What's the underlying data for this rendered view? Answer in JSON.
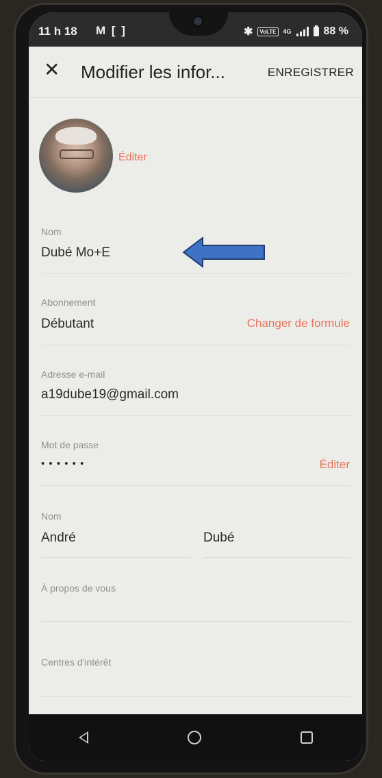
{
  "status_bar": {
    "time": "11 h 18",
    "left_icons": "M [ ]",
    "network_label": "4G",
    "volte_label": "VoLTE",
    "battery": "88 %"
  },
  "app_bar": {
    "title": "Modifier les infor...",
    "save_label": "ENREGISTRER"
  },
  "profile": {
    "edit_photo_label": "Éditer"
  },
  "fields": {
    "name": {
      "label": "Nom",
      "value": "Dubé Mo+E"
    },
    "subscription": {
      "label": "Abonnement",
      "value": "Débutant",
      "action": "Changer de formule"
    },
    "email": {
      "label": "Adresse e-mail",
      "value": "a19dube19@gmail.com"
    },
    "password": {
      "label": "Mot de passe",
      "value": "• • • • • •",
      "action": "Éditer"
    },
    "full_name": {
      "label": "Nom",
      "first_name": "André",
      "last_name": "Dubé"
    },
    "about": {
      "label": "À propos de vous",
      "value": ""
    },
    "interests": {
      "label": "Centres d'intérêt",
      "value": ""
    }
  },
  "colors": {
    "accent": "#e8745a",
    "arrow": "#3f72c4",
    "background": "#ecece8"
  }
}
